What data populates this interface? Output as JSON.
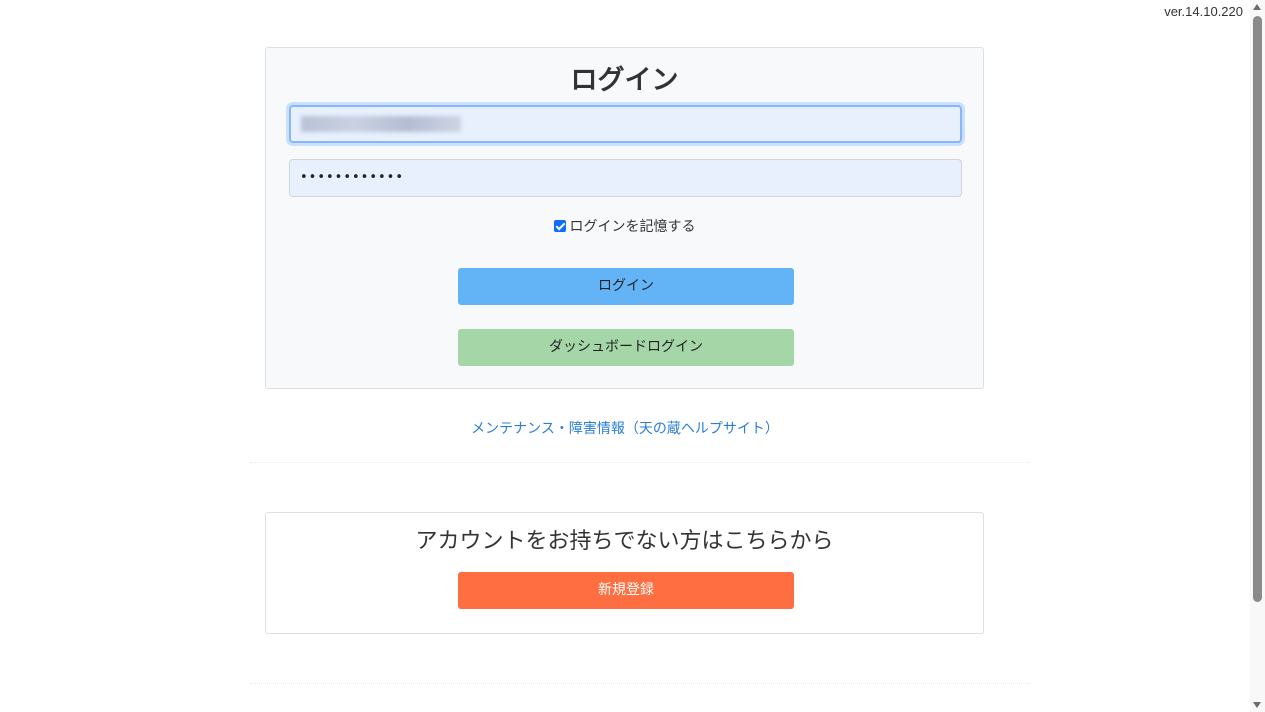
{
  "version": "ver.14.10.220",
  "login": {
    "title": "ログイン",
    "email_value": "",
    "password_value": "••••••••••••",
    "remember_label": "ログインを記憶する",
    "remember_checked": true,
    "login_button": "ログイン",
    "dashboard_button": "ダッシュボードログイン"
  },
  "help_link": "メンテナンス・障害情報（天の蔵ヘルプサイト）",
  "signup": {
    "title": "アカウントをお持ちでない方はこちらから",
    "register_button": "新規登録"
  },
  "colors": {
    "login_button": "#63b3f7",
    "dashboard_button": "#a5d6a7",
    "register_button": "#ff6e40",
    "link": "#2a7fd4"
  }
}
